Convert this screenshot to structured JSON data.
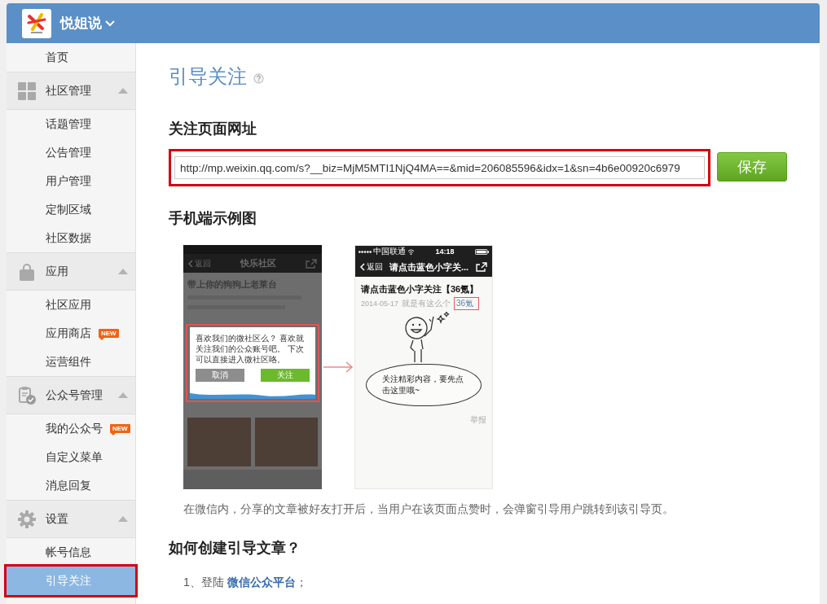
{
  "header": {
    "title": "悦姐说"
  },
  "sidebar": {
    "items": [
      {
        "kind": "link",
        "label": "首页",
        "selected": false,
        "highlighted": false
      },
      {
        "kind": "group",
        "label": "社区管理",
        "expanded": true,
        "children": [
          {
            "label": "话题管理",
            "selected": false,
            "highlighted": false
          },
          {
            "label": "公告管理",
            "selected": false,
            "highlighted": false
          },
          {
            "label": "用户管理",
            "selected": false,
            "highlighted": false
          },
          {
            "label": "定制区域",
            "selected": false,
            "highlighted": false
          },
          {
            "label": "社区数据",
            "selected": false,
            "highlighted": false
          }
        ]
      },
      {
        "kind": "group",
        "label": "应用",
        "expanded": true,
        "children": [
          {
            "label": "社区应用",
            "selected": false,
            "highlighted": false
          },
          {
            "label": "应用商店",
            "badge": "NEW",
            "selected": false,
            "highlighted": false
          },
          {
            "label": "运营组件",
            "selected": false,
            "highlighted": false
          }
        ]
      },
      {
        "kind": "group",
        "label": "公众号管理",
        "expanded": true,
        "children": [
          {
            "label": "我的公众号",
            "badge": "NEW",
            "selected": false,
            "highlighted": false
          },
          {
            "label": "自定义菜单",
            "selected": false,
            "highlighted": false
          },
          {
            "label": "消息回复",
            "selected": false,
            "highlighted": false
          }
        ]
      },
      {
        "kind": "group",
        "label": "设置",
        "expanded": true,
        "children": [
          {
            "label": "帐号信息",
            "selected": false,
            "highlighted": false
          },
          {
            "label": "引导关注",
            "selected": true,
            "highlighted": true
          }
        ]
      }
    ]
  },
  "main": {
    "title": "引导关注",
    "url_section": {
      "heading": "关注页面网址",
      "url": "http://mp.weixin.qq.com/s?__biz=MjM5MTI1NjQ4MA==&mid=206085596&idx=1&sn=4b6e00920c6979",
      "highlighted": true,
      "save_button": "保存"
    },
    "example_section": {
      "heading": "手机端示例图",
      "screens": [
        {
          "kind": "popup",
          "nav_back": "返回",
          "nav_title": "快乐社区",
          "post_title": "带上你的狗狗上老莱台",
          "dialog_text": "喜欢我们的微社区么？ 喜欢就关注我们的公众账号吧。 下次可以直接进入微社区咯。",
          "cancel_button": "取消",
          "follow_button": "关注",
          "highlighted": true
        },
        {
          "kind": "article",
          "carrier": "中国联通",
          "time": "14:18",
          "nav_back": "返回",
          "nav_title": "请点击蓝色小字关...",
          "title": "请点击蓝色小字关注【36氪】",
          "date": "2014-05-17",
          "author": "就是有这么个",
          "account": "36氪",
          "account_highlighted": true,
          "bubble_text": "关注精彩内容，要先点击这里哦~",
          "report": "举报"
        }
      ],
      "caption": "在微信内，分享的文章被好友打开后，当用户在该页面点赞时，会弹窗引导用户跳转到该引导页。"
    },
    "howto_section": {
      "heading": "如何创建引导文章？",
      "steps": [
        {
          "prefix": "1、登陆",
          "link": "微信公众平台",
          "suffix": "；"
        }
      ]
    }
  }
}
